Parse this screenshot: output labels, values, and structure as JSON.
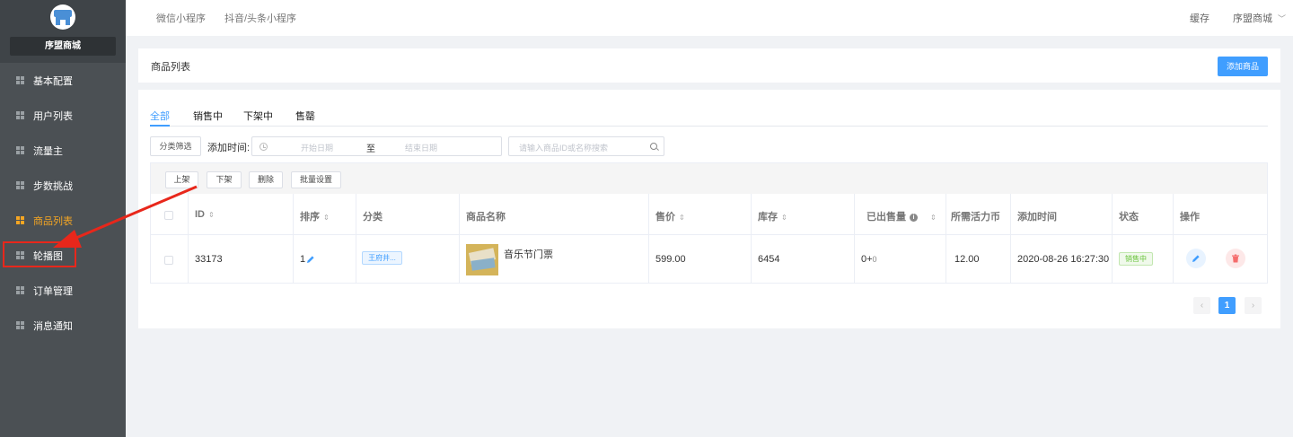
{
  "sidebar": {
    "brand": "序盟商城",
    "items": [
      {
        "label": "基本配置"
      },
      {
        "label": "用户列表"
      },
      {
        "label": "流量主"
      },
      {
        "label": "步数挑战"
      },
      {
        "label": "商品列表",
        "active": true
      },
      {
        "label": "轮播图"
      },
      {
        "label": "订单管理"
      },
      {
        "label": "消息通知"
      }
    ]
  },
  "topbar": {
    "tabs": [
      "微信小程序",
      "抖音/头条小程序"
    ],
    "cache": "缓存",
    "account": "序盟商城"
  },
  "header": {
    "title": "商品列表",
    "add_button": "添加商品"
  },
  "tabs": [
    "全部",
    "销售中",
    "下架中",
    "售罄"
  ],
  "filters": {
    "category_button": "分类筛选",
    "date_label": "添加时间:",
    "start_placeholder": "开始日期",
    "separator": "至",
    "end_placeholder": "结束日期",
    "search_placeholder": "请输入商品ID或名称搜索"
  },
  "actions": [
    "上架",
    "下架",
    "删除",
    "批量设置"
  ],
  "table": {
    "columns": [
      "ID",
      "排序",
      "分类",
      "商品名称",
      "售价",
      "库存",
      "已出售量",
      "所需活力币",
      "添加时间",
      "状态",
      "操作"
    ],
    "rows": [
      {
        "id": "33173",
        "sort": "1",
        "category": "王府井...",
        "name": "音乐节门票",
        "price": "599.00",
        "stock": "6454",
        "sold": "0+",
        "sold_extra": "0",
        "coins": "12.00",
        "added": "2020-08-26 16:27:30",
        "status": "销售中"
      }
    ]
  },
  "pagination": {
    "current": "1"
  },
  "colors": {
    "accent": "#409eff",
    "sidebar_bg": "#4b5054",
    "active_menu": "#f5a623",
    "annotation_red": "#e8271b"
  }
}
